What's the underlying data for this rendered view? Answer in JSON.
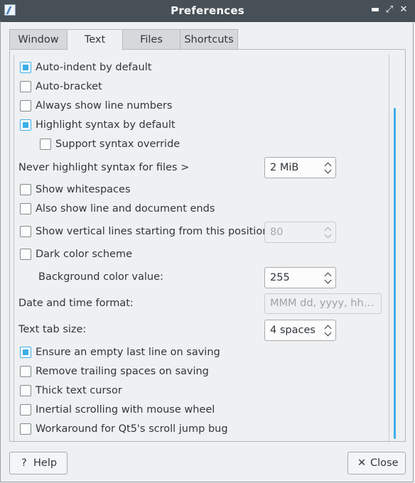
{
  "window": {
    "title": "Preferences",
    "minimize": "▬",
    "maximize": "⤢",
    "close": "✕"
  },
  "tabs": [
    {
      "label": "Window",
      "active": false
    },
    {
      "label": "Text",
      "active": true
    },
    {
      "label": "Files",
      "active": false
    },
    {
      "label": "Shortcuts",
      "active": false
    }
  ],
  "options": {
    "auto_indent": {
      "label": "Auto-indent by default",
      "checked": true
    },
    "auto_bracket": {
      "label": "Auto-bracket",
      "checked": false
    },
    "line_numbers": {
      "label": "Always show line numbers",
      "checked": false
    },
    "highlight_syntax": {
      "label": "Highlight syntax by default",
      "checked": true
    },
    "syntax_override": {
      "label": "Support syntax override",
      "checked": false
    },
    "never_highlight": {
      "label": "Never highlight syntax for files >",
      "value": "2 MiB"
    },
    "show_whitespaces": {
      "label": "Show whitespaces",
      "checked": false
    },
    "show_line_ends": {
      "label": "Also show line and document ends",
      "checked": false
    },
    "vertical_lines": {
      "label": "Show vertical lines starting from this position:",
      "checked": false,
      "value": "80"
    },
    "dark_scheme": {
      "label": "Dark color scheme",
      "checked": false
    },
    "bg_color": {
      "label": "Background color value:",
      "value": "255"
    },
    "date_format": {
      "label": "Date and time format:",
      "placeholder": "MMM dd, yyyy, hh:mm:ss"
    },
    "tab_size": {
      "label": "Text tab size:",
      "value": "4 spaces"
    },
    "empty_last_line": {
      "label": "Ensure an empty last line on saving",
      "checked": true
    },
    "trailing_spaces": {
      "label": "Remove trailing spaces on saving",
      "checked": false
    },
    "thick_cursor": {
      "label": "Thick text cursor",
      "checked": false
    },
    "inertial_scroll": {
      "label": "Inertial scrolling with mouse wheel",
      "checked": false
    },
    "qt5_workaround": {
      "label": "Workaround for Qt5's scroll jump bug",
      "checked": false
    }
  },
  "footer": {
    "help": {
      "icon": "?",
      "label": "Help"
    },
    "close": {
      "icon": "✕",
      "label": "Close"
    }
  },
  "colors": {
    "accent": "#3daee9",
    "titlebar": "#475057",
    "background": "#eff0f1"
  }
}
